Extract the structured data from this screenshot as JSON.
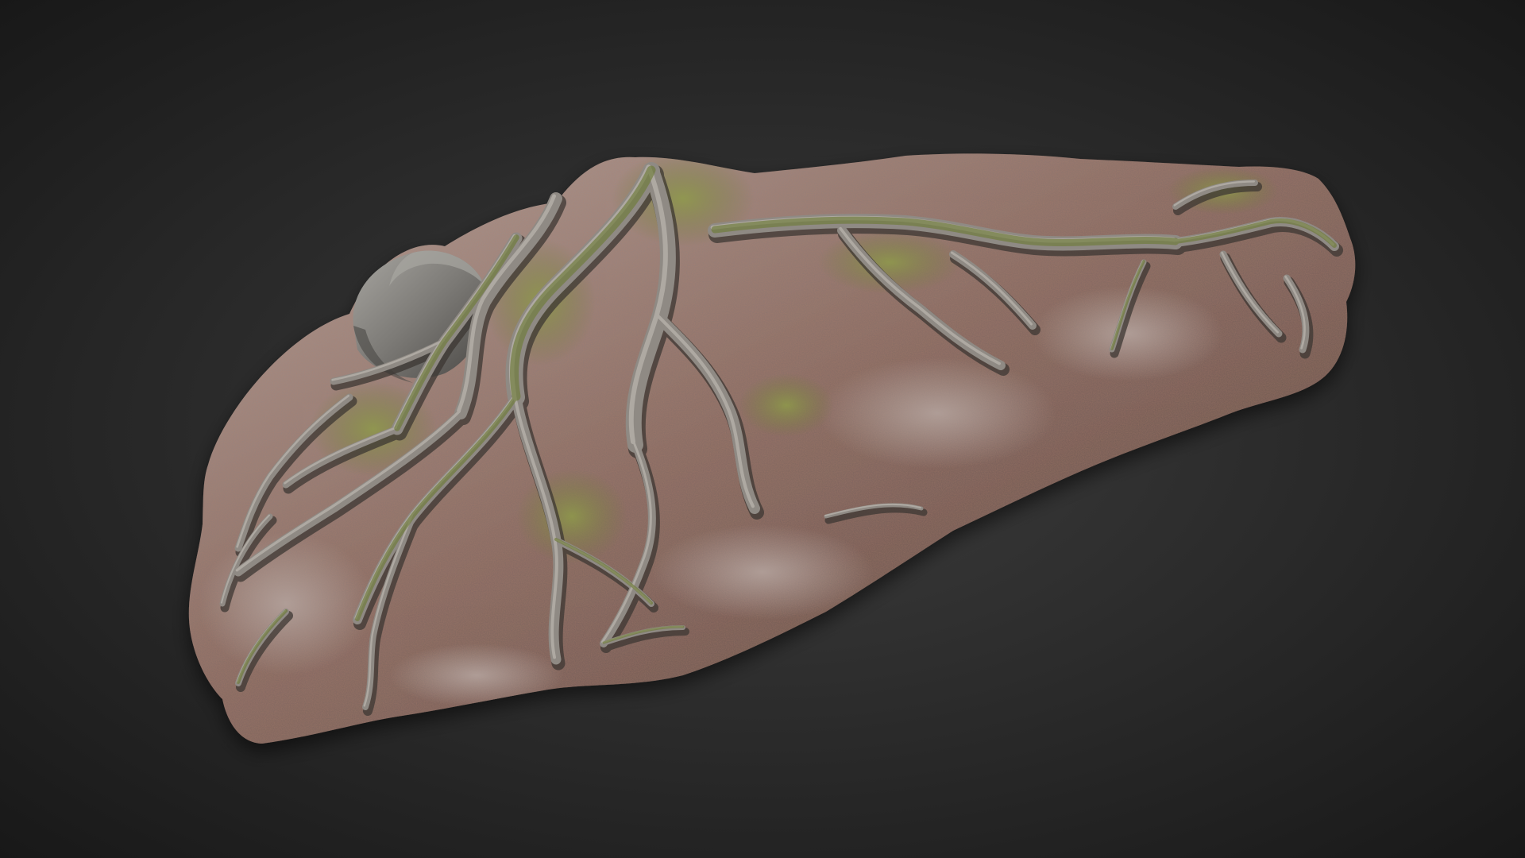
{
  "scene": {
    "background": {
      "center_color": "#3d3d3d",
      "edge_color": "#161616"
    },
    "model": {
      "soil_color": "#8a6e66",
      "soil_light_color": "#b3a29c",
      "soil_dark_color": "#5a453f",
      "needle_color": "#9a5a40",
      "root_color": "#8f8a84",
      "root_light_color": "#c9c3bc",
      "root_shadow_color": "#3c3733",
      "moss_color": "#6f7a38",
      "moss_light_color": "#8e9a4a",
      "rock_color": "#7c7a76",
      "rock_light_color": "#a8a6a1",
      "rock_dark_color": "#4a4845"
    }
  }
}
